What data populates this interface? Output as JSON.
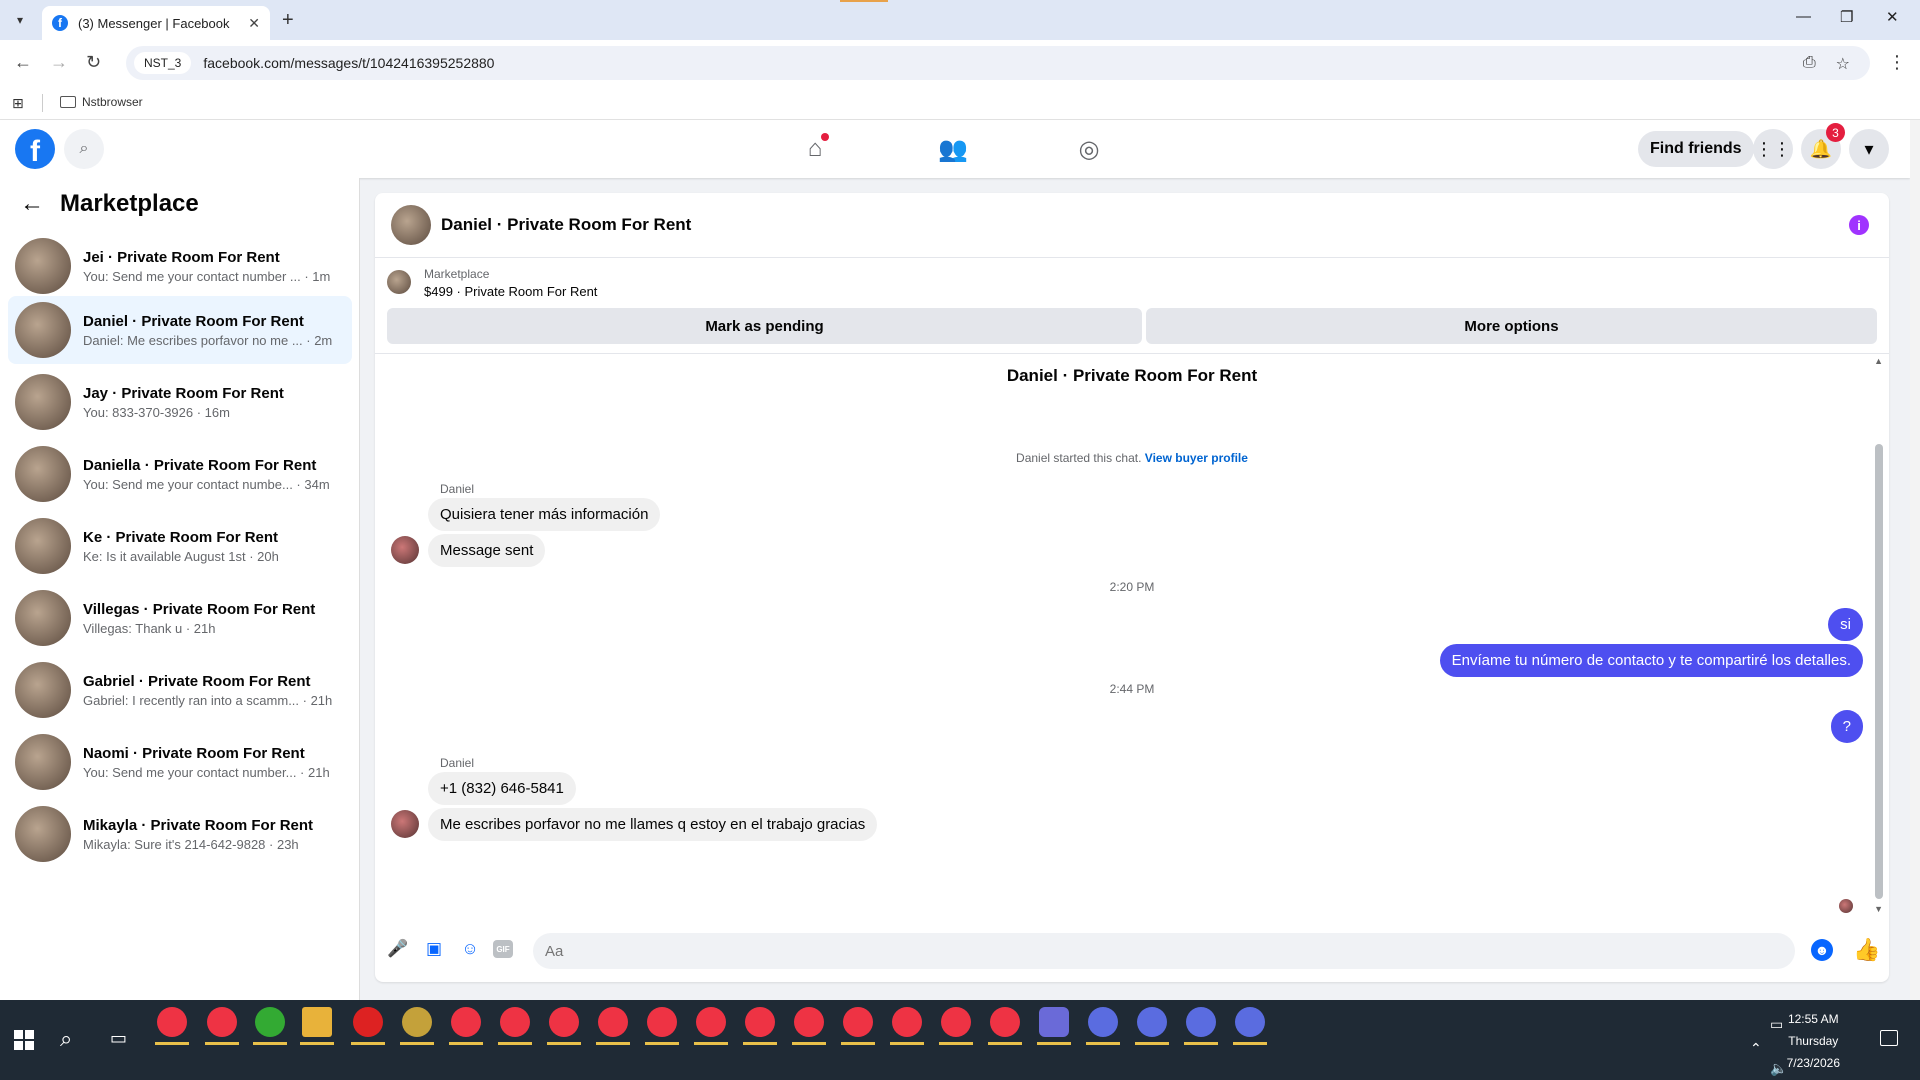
{
  "browser": {
    "tab_title": "(3) Messenger | Facebook",
    "profile_chip": "NST_3",
    "url": "facebook.com/messages/t/1042416395252880",
    "bookmark": "Nstbrowser"
  },
  "fb_nav": {
    "find_friends": "Find friends",
    "notification_count": "3"
  },
  "sidebar": {
    "title": "Marketplace",
    "conversations": [
      {
        "name": "Jei · Private Room For Rent",
        "snippet": "You: Send me your contact number ... · 1m"
      },
      {
        "name": "Daniel · Private Room For Rent",
        "snippet": "Daniel: Me escribes porfavor no me ... · 2m"
      },
      {
        "name": "Jay · Private Room For Rent",
        "snippet": "You: 833-370-3926 · 16m"
      },
      {
        "name": "Daniella · Private Room For Rent",
        "snippet": "You: Send me your contact numbe... · 34m"
      },
      {
        "name": "Ke · Private Room For Rent",
        "snippet": "Ke: Is it available August 1st · 20h"
      },
      {
        "name": "Villegas · Private Room For Rent",
        "snippet": "Villegas: Thank u · 21h"
      },
      {
        "name": "Gabriel · Private Room For Rent",
        "snippet": "Gabriel: I recently ran into a scamm... · 21h"
      },
      {
        "name": "Naomi · Private Room For Rent",
        "snippet": "You: Send me your contact number... · 21h"
      },
      {
        "name": "Mikayla · Private Room For Rent",
        "snippet": "Mikayla: Sure it's 214-642-9828 · 23h"
      }
    ]
  },
  "chat": {
    "header_name": "Daniel · Private Room For Rent",
    "listing_label": "Marketplace",
    "listing_item": "$499 · Private Room For Rent",
    "mark_pending": "Mark as pending",
    "more_options": "More options",
    "thread_title": "Daniel · Private Room For Rent",
    "system_text": "Daniel started this chat.",
    "system_link": "View buyer profile",
    "sender1": "Daniel",
    "msg1": "Quisiera tener más información",
    "msg2": "Message sent",
    "time1": "2:20 PM",
    "out1": "si",
    "out2": "Envíame tu número de contacto y te compartiré los detalles.",
    "time2": "2:44 PM",
    "out3": "?",
    "sender2": "Daniel",
    "msg3": "+1 (832) 646-5841",
    "msg4": "Me escribes porfavor no me llames q estoy en el trabajo gracias",
    "composer_placeholder": "Aa"
  },
  "taskbar": {
    "time": "12:55 AM",
    "day": "Thursday",
    "date": "7/23/2026"
  },
  "colors": {
    "fb_blue": "#1877f2",
    "outgoing_bubble": "#4e4ff0",
    "active_conversation": "#ebf5ff"
  }
}
